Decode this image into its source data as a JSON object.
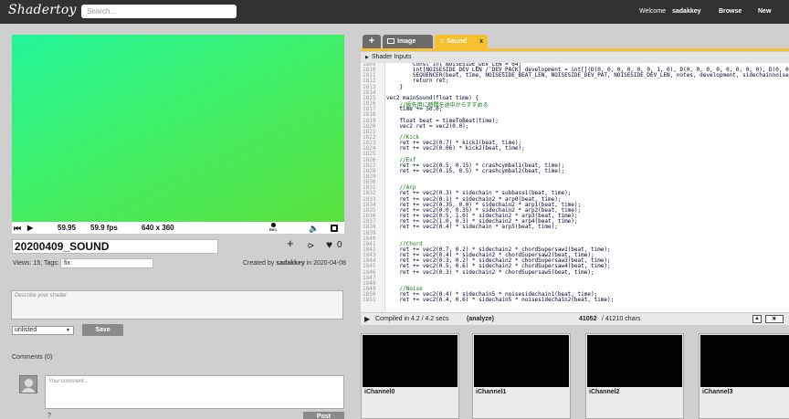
{
  "header": {
    "logo": "Shadertoy",
    "search_placeholder": "Search...",
    "welcome": "Welcome",
    "username": "sadakkey",
    "browse": "Browse",
    "new": "New"
  },
  "player": {
    "time": "59.95",
    "fps": "59.9 fps",
    "resolution": "640 x 360",
    "rec_label": "REC"
  },
  "shader": {
    "title": "20200409_SOUND",
    "views_tags": "Views: 15, Tags:",
    "tag": "fix",
    "created_prefix": "Created by",
    "author": "sadakkey",
    "created_suffix": "in 2020-04-08",
    "likes": "0",
    "description_placeholder": "Describe your shader",
    "privacy": "unlisted",
    "save": "Save"
  },
  "comments": {
    "heading": "Comments (0)",
    "placeholder": "Your comment...",
    "help": "?",
    "post": "Post"
  },
  "tabs": {
    "new": "+",
    "image": "Image",
    "sound": "Sound",
    "close": "x"
  },
  "shader_inputs": "Shader Inputs",
  "code": {
    "lines": [
      {
        "n": "1809",
        "t": "        const int NOISESIDE_DEV_LEN = 64;",
        "c": false
      },
      {
        "n": "1810",
        "t": "        int[NOISESIDE_DEV_LEN / DEV_PACK] development = int[](D(0, 0, 0, 0, 0, 0, 1, 0), D(0, 0, 0, 0, 0, 0, 0, 0), D(0, 0",
        "c": false
      },
      {
        "n": "1811",
        "t": "        SEQUENCER(beat, time, NOISESIDE_BEAT_LEN, NOISESIDE_DEV_PAT, NOISESIDE_DEV_LEN, notes, development, sidechainnoise",
        "c": false
      },
      {
        "n": "1812",
        "t": "        return ret;",
        "c": false
      },
      {
        "n": "1813",
        "t": "    }",
        "c": false
      },
      {
        "n": "1814",
        "t": "",
        "c": false
      },
      {
        "n": "1815",
        "t": "vec2 mainSound(float time) {",
        "c": false
      },
      {
        "n": "1816",
        "t": "    //掘先用に時間を途中からすすめる",
        "c": true
      },
      {
        "n": "1817",
        "t": "    time += 50.0;",
        "c": false
      },
      {
        "n": "1818",
        "t": "",
        "c": false
      },
      {
        "n": "1819",
        "t": "    float beat = timeToBeat(time);",
        "c": false
      },
      {
        "n": "1820",
        "t": "    vec2 ret = vec2(0.0);",
        "c": false
      },
      {
        "n": "1821",
        "t": "",
        "c": false
      },
      {
        "n": "1822",
        "t": "    //Kick",
        "c": true
      },
      {
        "n": "1823",
        "t": "    ret += vec2(0.7) * kick1(beat, time);",
        "c": false
      },
      {
        "n": "1824",
        "t": "    ret += vec2(0.06) * kick2(beat, time);",
        "c": false
      },
      {
        "n": "1825",
        "t": "",
        "c": false
      },
      {
        "n": "1826",
        "t": "    //Exf",
        "c": true
      },
      {
        "n": "1827",
        "t": "    ret += vec2(0.5, 0.15) * crashcymbal1(beat, time);",
        "c": false
      },
      {
        "n": "1828",
        "t": "    ret += vec2(0.15, 0.5) * crashcymbal2(beat, time);",
        "c": false
      },
      {
        "n": "1829",
        "t": "",
        "c": false
      },
      {
        "n": "1830",
        "t": "",
        "c": false
      },
      {
        "n": "1831",
        "t": "    //Arp",
        "c": true
      },
      {
        "n": "1832",
        "t": "    ret += vec2(0.3) * sidechain * subbass1(beat, time);",
        "c": false
      },
      {
        "n": "1833",
        "t": "    ret += vec2(0.1) * sidechain2 * arp0(beat, time);",
        "c": false
      },
      {
        "n": "1834",
        "t": "    ret += vec2(0.35, 0.0) * sidechain2 * arp1(beat, time);",
        "c": false
      },
      {
        "n": "1835",
        "t": "    ret += vec2(0.0, 0.35) * sidechain2 * arp2(beat, time);",
        "c": false
      },
      {
        "n": "1836",
        "t": "    ret += vec2(0.5, 1.0) * sidechain2 * arp3(beat, time);",
        "c": false
      },
      {
        "n": "1837",
        "t": "    ret += vec2(1.0, 0.3) * sidechain2 * arp4(beat, time);",
        "c": false
      },
      {
        "n": "1838",
        "t": "    ret += vec2(0.4) * sidechain * arp5(beat, time);",
        "c": false
      },
      {
        "n": "1839",
        "t": "",
        "c": false
      },
      {
        "n": "1840",
        "t": "",
        "c": false
      },
      {
        "n": "1841",
        "t": "    //Chord",
        "c": true
      },
      {
        "n": "1842",
        "t": "    ret += vec2(0.7, 0.2) * sidechain2 * chordSupersaw1(beat, time);",
        "c": false
      },
      {
        "n": "1843",
        "t": "    ret += vec2(0.4) * sidechain2 * chordSupersaw2(beat, time);",
        "c": false
      },
      {
        "n": "1844",
        "t": "    ret += vec2(0.3, 0.2) * sidechain2 * chordSupersaw3(beat, time);",
        "c": false
      },
      {
        "n": "1845",
        "t": "    ret += vec2(0.5, 0.6) * sidechain2 * chordSupersaw4(beat, time);",
        "c": false
      },
      {
        "n": "1846",
        "t": "    ret += vec2(0.3) * sidechain2 * chordSupersaw5(beat, time);",
        "c": false
      },
      {
        "n": "1847",
        "t": "",
        "c": false
      },
      {
        "n": "1848",
        "t": "",
        "c": false
      },
      {
        "n": "1849",
        "t": "    //Noise",
        "c": true
      },
      {
        "n": "1850",
        "t": "    ret += vec2(0.4) * sidechain5 * noisesidechain1(beat, time);",
        "c": false
      },
      {
        "n": "1851",
        "t": "    ret += vec2(0.4, 0.6) * sidechain5 * noisesidechain2(beat, time);",
        "c": false
      }
    ]
  },
  "compile": {
    "status": "Compiled in 4.2 / 4.2 secs",
    "analyze": "(analyze)",
    "chars_used": "41052",
    "chars_total": "/ 41210 chars",
    "mode": "X"
  },
  "channels": [
    {
      "label": "iChannel0"
    },
    {
      "label": "iChannel1"
    },
    {
      "label": "iChannel2"
    },
    {
      "label": "iChannel3"
    }
  ]
}
